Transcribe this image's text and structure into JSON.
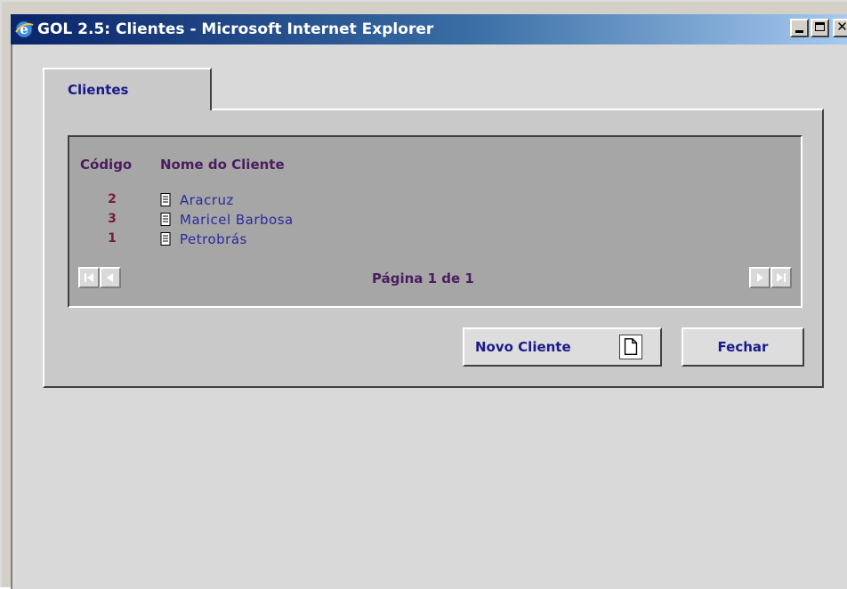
{
  "window": {
    "title": "GOL 2.5: Clientes - Microsoft Internet Explorer"
  },
  "tab": {
    "label": "Clientes"
  },
  "table": {
    "columns": [
      "Código",
      "Nome do Cliente"
    ],
    "rows": [
      {
        "code": "2",
        "name": "Aracruz"
      },
      {
        "code": "3",
        "name": "Maricel Barbosa"
      },
      {
        "code": "1",
        "name": "Petrobrás"
      }
    ]
  },
  "pager": {
    "label": "Página 1 de 1"
  },
  "buttons": {
    "new_client": "Novo Cliente",
    "close": "Fechar"
  },
  "colors": {
    "titlebar_start": "#0a246a",
    "titlebar_end": "#a6caf0",
    "link": "#2a2a9a",
    "code": "#7a1c2e",
    "header": "#4b1d5e"
  }
}
